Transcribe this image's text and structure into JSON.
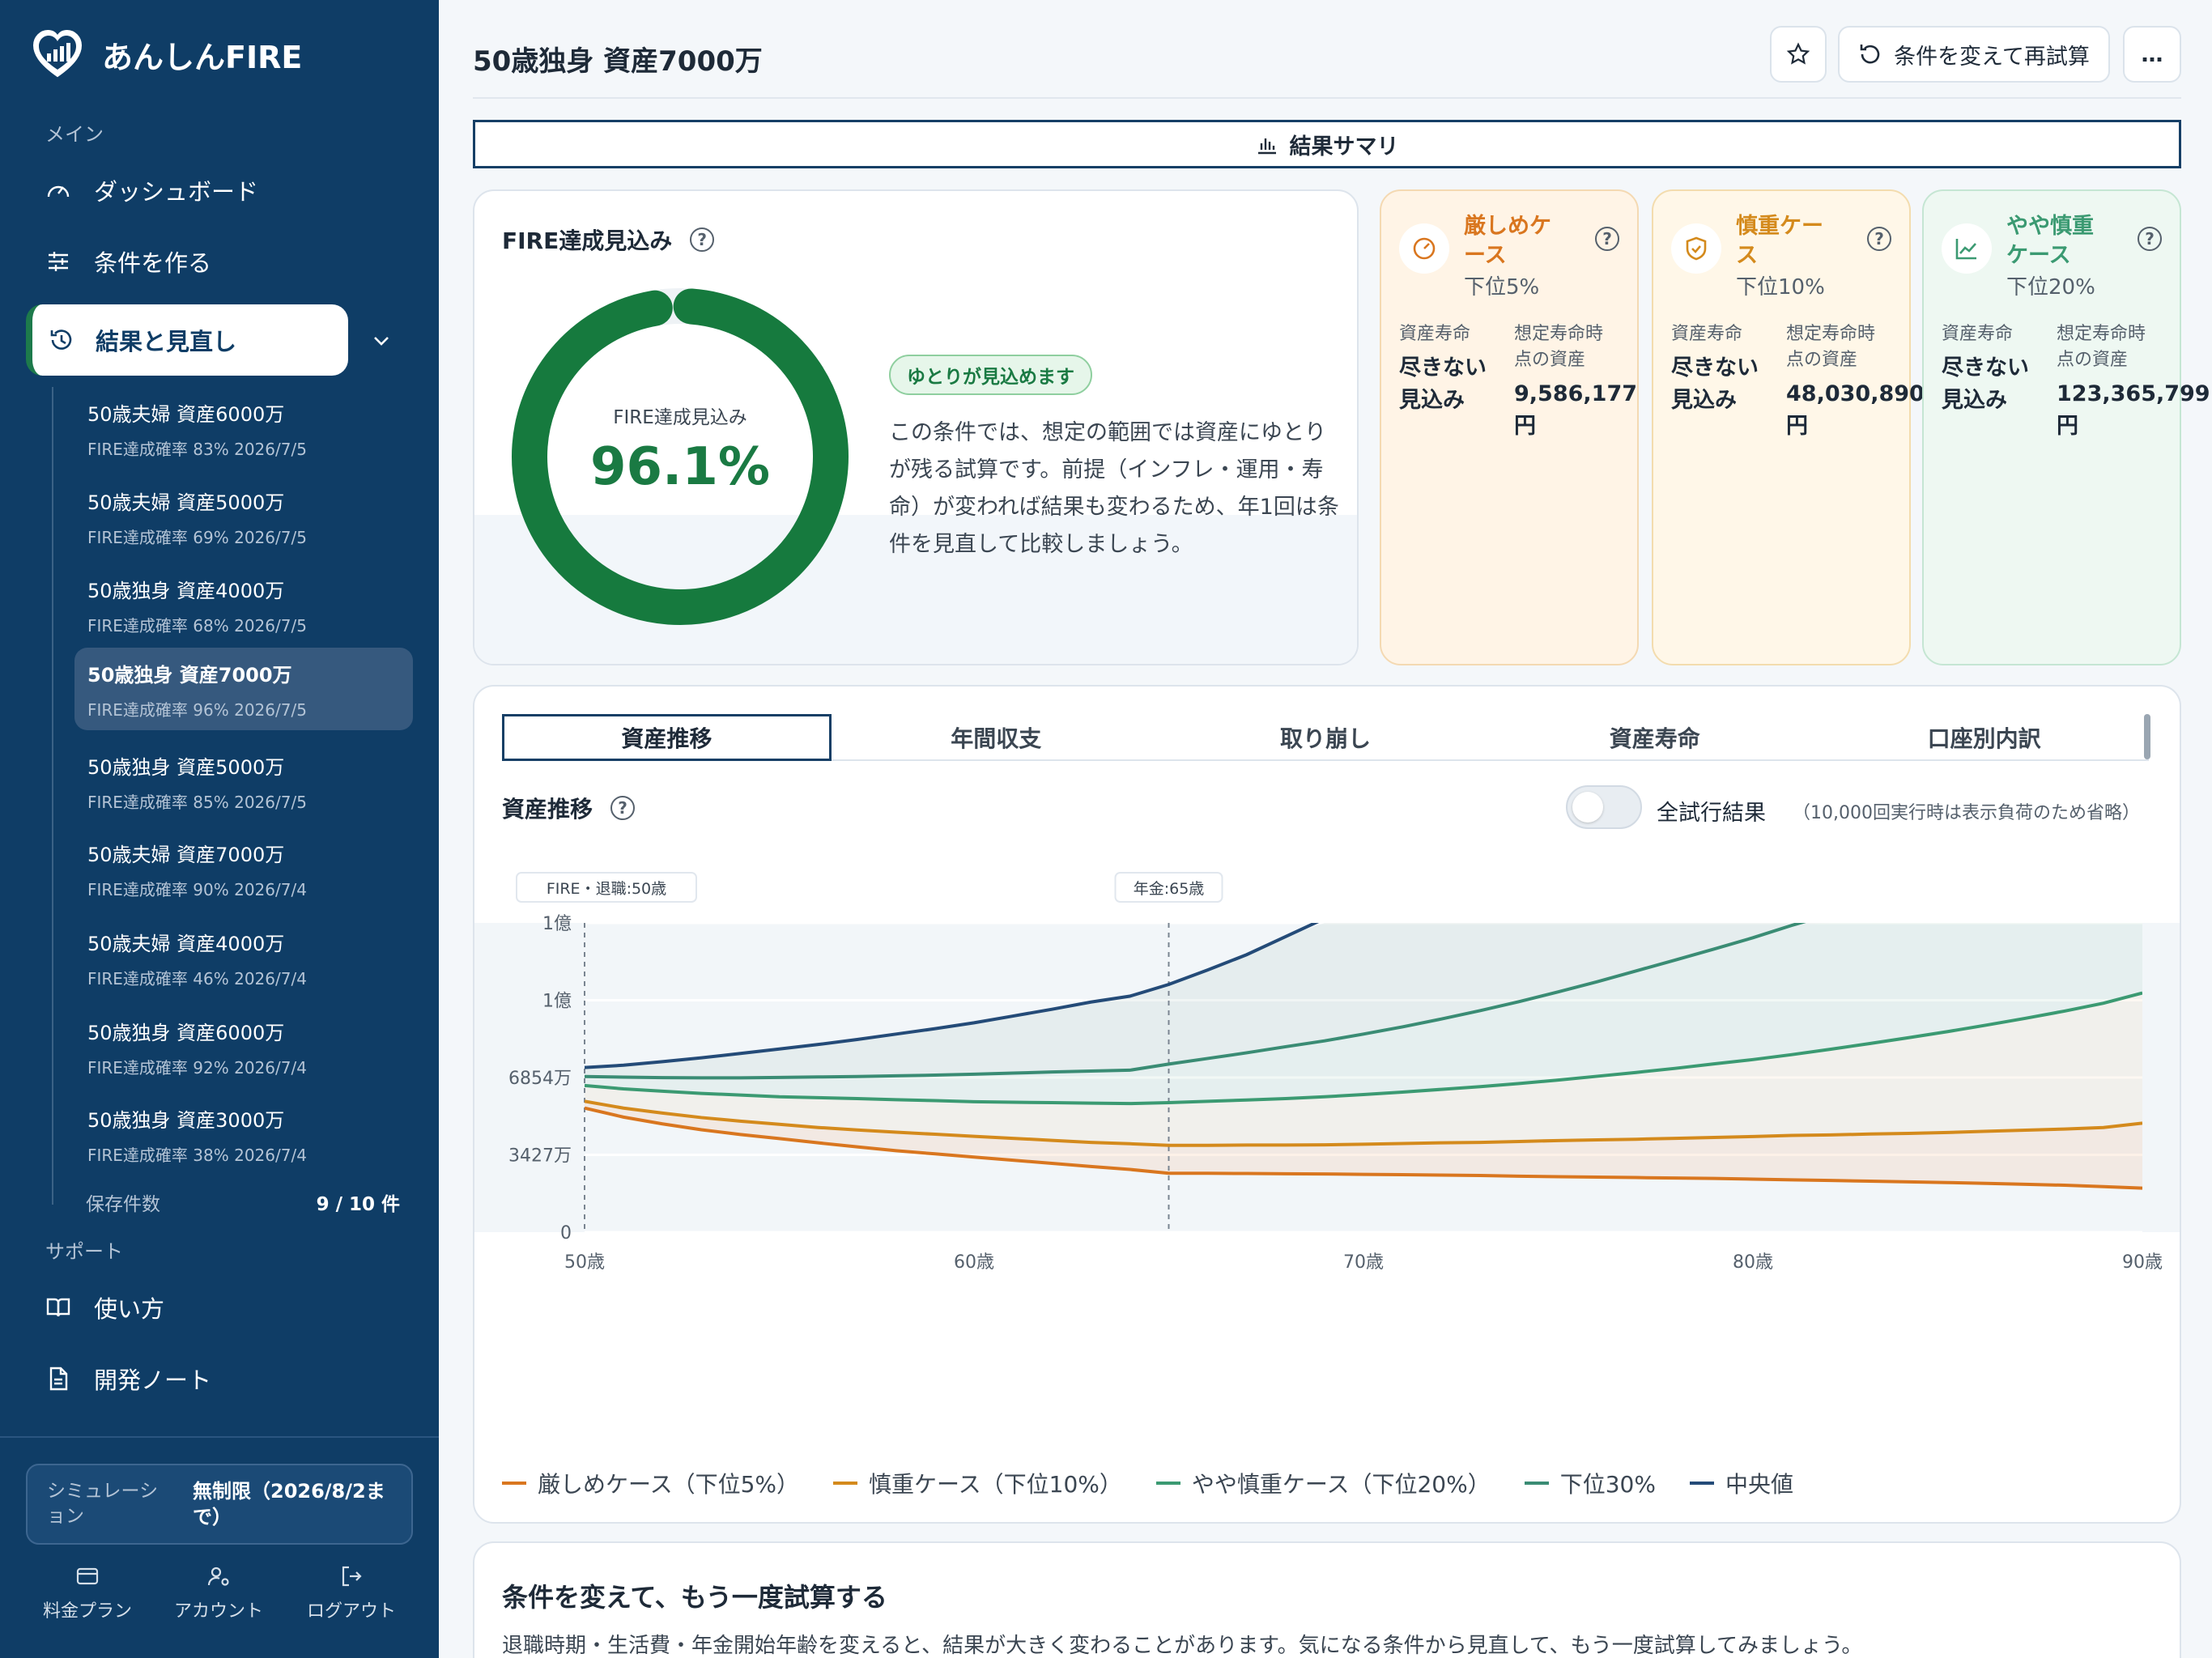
{
  "app": {
    "name": "あんしんFIRE"
  },
  "sidebar": {
    "main_label": "メイン",
    "nav": {
      "dashboard": "ダッシュボード",
      "create": "条件を作る",
      "results": "結果と見直し"
    },
    "results": [
      {
        "title": "50歳夫婦 資産6000万",
        "meta": "FIRE達成確率 83% 2026/7/5"
      },
      {
        "title": "50歳夫婦 資産5000万",
        "meta": "FIRE達成確率 69% 2026/7/5"
      },
      {
        "title": "50歳独身 資産4000万",
        "meta": "FIRE達成確率 68% 2026/7/5"
      },
      {
        "title": "50歳独身 資産7000万",
        "meta": "FIRE達成確率 96% 2026/7/5"
      },
      {
        "title": "50歳独身 資産5000万",
        "meta": "FIRE達成確率 85% 2026/7/5"
      },
      {
        "title": "50歳夫婦 資産7000万",
        "meta": "FIRE達成確率 90% 2026/7/4"
      },
      {
        "title": "50歳夫婦 資産4000万",
        "meta": "FIRE達成確率 46% 2026/7/4"
      },
      {
        "title": "50歳独身 資産6000万",
        "meta": "FIRE達成確率 92% 2026/7/4"
      },
      {
        "title": "50歳独身 資産3000万",
        "meta": "FIRE達成確率 38% 2026/7/4"
      }
    ],
    "saved_label": "保存件数",
    "saved_value": "9 / 10 件",
    "support_label": "サポート",
    "support": {
      "howto": "使い方",
      "devnotes": "開発ノート"
    },
    "plan": {
      "label": "シミュレーション",
      "value": "無制限（2026/8/2まで）"
    },
    "footer": {
      "pricing": "料金プラン",
      "account": "アカウント",
      "logout": "ログアウト"
    }
  },
  "header": {
    "title": "50歳独身 資産7000万",
    "retry_label": "条件を変えて再試算",
    "more_label": "…",
    "summary_tab": "結果サマリ"
  },
  "fire": {
    "title": "FIRE達成見込み",
    "center_label": "FIRE達成見込み",
    "value": "96.1%",
    "probability": 96.1,
    "badge": "ゆとりが見込めます",
    "description": "この条件では、想定の範囲では資産にゆとりが残る試算です。前提（インフレ・運用・寿命）が変われば結果も変わるため、年1回は条件を見直して比較しましょう。"
  },
  "cases": [
    {
      "name": "厳しめケース",
      "pct": "下位5%",
      "life_label": "資産寿命",
      "life_value": "尽きない見込み",
      "asset_label": "想定寿命時点の資産",
      "asset_value": "9,586,177円",
      "color": "#d9761f",
      "bg": "#fff4e6",
      "border": "#f4d9b2",
      "icon": "gauge-icon"
    },
    {
      "name": "慎重ケース",
      "pct": "下位10%",
      "life_label": "資産寿命",
      "life_value": "尽きない見込み",
      "asset_label": "想定寿命時点の資産",
      "asset_value": "48,030,890円",
      "color": "#d48a1c",
      "bg": "#fff7e8",
      "border": "#f3dcae",
      "icon": "shield-icon"
    },
    {
      "name": "やや慎重ケース",
      "pct": "下位20%",
      "life_label": "資産寿命",
      "life_value": "尽きない見込み",
      "asset_label": "想定寿命時点の資産",
      "asset_value": "123,365,799円",
      "color": "#3b9a72",
      "bg": "#eef8f2",
      "border": "#c5e6d3",
      "icon": "trend-icon"
    }
  ],
  "tabs": [
    "資産推移",
    "年間収支",
    "取り崩し",
    "資産寿命",
    "口座別内訳"
  ],
  "chart": {
    "title": "資産推移",
    "toggle_label": "全試行結果",
    "toggle_note": "（10,000回実行時は表示負荷のため省略）",
    "markers": [
      {
        "label": "FIRE・退職:50歳",
        "age": 50
      },
      {
        "label": "年金:65歳",
        "age": 65
      }
    ]
  },
  "chart_data": {
    "type": "line",
    "x": [
      50,
      51,
      52,
      53,
      54,
      55,
      56,
      57,
      58,
      59,
      60,
      61,
      62,
      63,
      64,
      65,
      66,
      67,
      68,
      69,
      70,
      71,
      72,
      73,
      74,
      75,
      76,
      77,
      78,
      79,
      80,
      81,
      82,
      83,
      84,
      85,
      86,
      87,
      88,
      89,
      90
    ],
    "x_ticks": [
      "50歳",
      "60歳",
      "70歳",
      "80歳",
      "90歳"
    ],
    "y_ticks": [
      "0",
      "3427万",
      "6854万",
      "1億",
      "1億"
    ],
    "ylim": [
      0,
      13708
    ],
    "series": [
      {
        "name": "厳しめケース（下位5%）",
        "color": "#d9761f",
        "values": [
          5500,
          5100,
          4800,
          4540,
          4330,
          4150,
          3960,
          3780,
          3610,
          3470,
          3330,
          3190,
          3050,
          2910,
          2780,
          2610,
          2610,
          2600,
          2590,
          2580,
          2560,
          2550,
          2530,
          2510,
          2480,
          2460,
          2440,
          2420,
          2400,
          2380,
          2350,
          2320,
          2290,
          2260,
          2230,
          2200,
          2160,
          2120,
          2080,
          2020,
          1950
        ]
      },
      {
        "name": "慎重ケース（下位10%）",
        "color": "#d48a1c",
        "values": [
          5800,
          5500,
          5280,
          5080,
          4920,
          4780,
          4640,
          4530,
          4430,
          4340,
          4250,
          4160,
          4070,
          3980,
          3920,
          3850,
          3850,
          3860,
          3860,
          3870,
          3900,
          3930,
          3960,
          3980,
          4020,
          4060,
          4090,
          4120,
          4160,
          4200,
          4240,
          4290,
          4310,
          4350,
          4380,
          4420,
          4470,
          4520,
          4570,
          4640,
          4830
        ]
      },
      {
        "name": "やや慎重ケース（下位20%）",
        "color": "#3b9a72",
        "values": [
          6500,
          6350,
          6250,
          6150,
          6080,
          6000,
          5960,
          5920,
          5870,
          5830,
          5780,
          5760,
          5740,
          5720,
          5700,
          5740,
          5800,
          5860,
          5920,
          6000,
          6100,
          6210,
          6330,
          6450,
          6590,
          6740,
          6910,
          7080,
          7260,
          7460,
          7650,
          7870,
          8110,
          8360,
          8620,
          8890,
          9180,
          9480,
          9800,
          10150,
          10600
        ]
      },
      {
        "name": "下位30%",
        "color": "#3a8c74",
        "values": [
          6900,
          6870,
          6850,
          6840,
          6840,
          6860,
          6880,
          6900,
          6930,
          6960,
          7000,
          7050,
          7100,
          7140,
          7180,
          7450,
          7700,
          7950,
          8220,
          8480,
          8780,
          9100,
          9450,
          9820,
          10220,
          10650,
          11100,
          11580,
          12060,
          12550,
          13050,
          13600,
          14100,
          14700,
          15300,
          15900,
          16500,
          17100,
          17700,
          18300,
          18900
        ]
      },
      {
        "name": "中央値",
        "color": "#244b78",
        "values": [
          7300,
          7400,
          7560,
          7730,
          7920,
          8120,
          8320,
          8540,
          8780,
          9020,
          9280,
          9580,
          9880,
          10200,
          10460,
          10980,
          11620,
          12300,
          13100,
          13900,
          14800,
          15700,
          16700,
          17700,
          18800,
          19900,
          21000,
          22100,
          23200,
          24300,
          25400,
          26500,
          27600,
          28700,
          29800,
          30900,
          32000,
          33100,
          34200,
          35300,
          36400
        ]
      }
    ]
  },
  "retry": {
    "title": "条件を変えて、もう一度試算する",
    "description": "退職時期・生活費・年金開始年齢を変えると、結果が大きく変わることがあります。気になる条件から見直して、もう一度試算してみましょう。"
  }
}
